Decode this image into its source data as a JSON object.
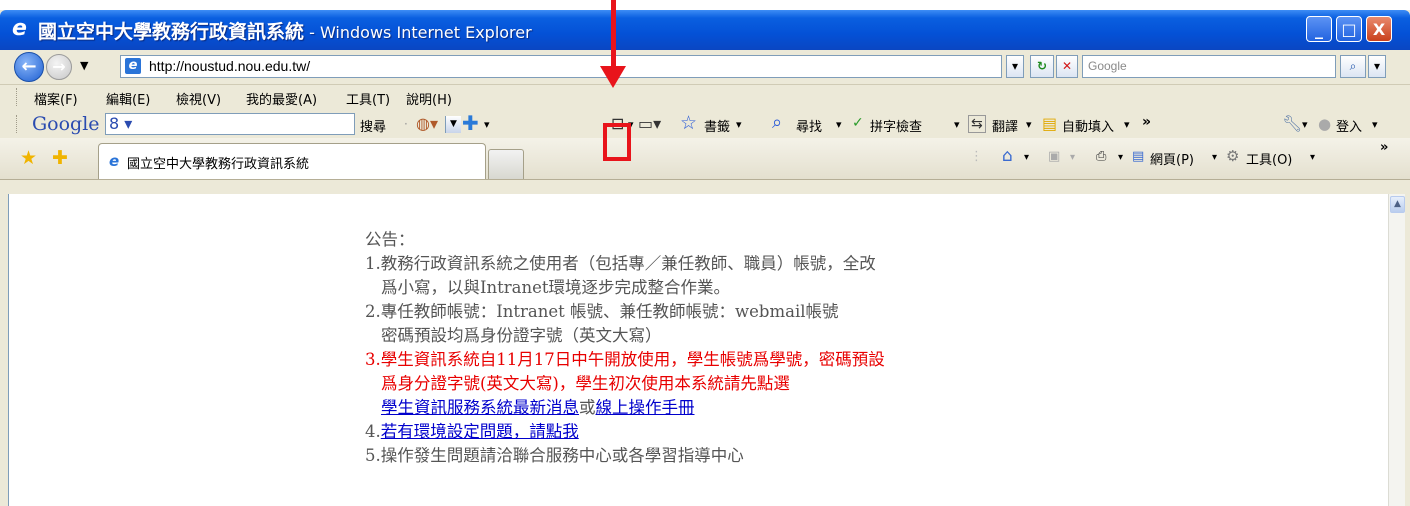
{
  "window": {
    "title": "國立空中大學教務行政資訊系統",
    "title_suffix": " - Windows Internet Explorer",
    "buttons": {
      "minimize": "_",
      "maximize": "□",
      "close": "X"
    }
  },
  "address": {
    "url": "http://noustud.nou.edu.tw/",
    "search_placeholder": "Google"
  },
  "menu": [
    "檔案(F)",
    "編輯(E)",
    "檢視(V)",
    "我的最愛(A)",
    "工具(T)",
    "說明(H)"
  ],
  "google_toolbar": {
    "logo": "Google",
    "search_label": "搜尋",
    "bookmarks": "書籤",
    "find": "尋找",
    "spellcheck": "拼字檢查",
    "translate": "翻譯",
    "autofill": "自動填入",
    "signin": "登入"
  },
  "tabs": {
    "active_tab": "國立空中大學教務行政資訊系統"
  },
  "commands": {
    "page": "網頁(P)",
    "tools": "工具(O)"
  },
  "notice": {
    "heading": "公告：",
    "line1a": "1.教務行政資訊系統之使用者（包括專／兼任教師、職員）帳號，全改",
    "line1b": "爲小寫，以與Intranet環境逐步完成整合作業。",
    "line2a": "2.專任教師帳號：Intranet 帳號、兼任教師帳號：webmail帳號",
    "line2b": "密碼預設均爲身份證字號（英文大寫）",
    "line3a": "3.學生資訊系統自11月17日中午開放使用，學生帳號爲學號，密碼預設",
    "line3b": "爲身分證字號(英文大寫)，學生初次使用本系統請先點選",
    "link_news": "學生資訊服務系統最新消息",
    "or": "或",
    "link_manual": "線上操作手冊",
    "line4_prefix": "4.",
    "link_env": "若有環境設定問題，請點我",
    "line5": "5.操作發生問題請洽聯合服務中心或各學習指導中心"
  }
}
